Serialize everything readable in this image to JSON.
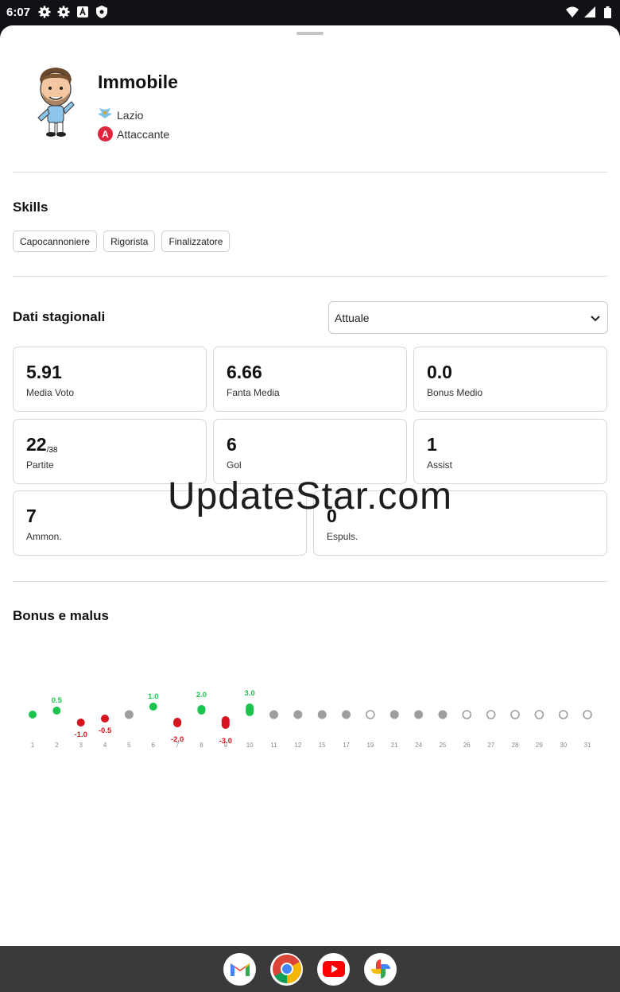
{
  "status": {
    "time": "6:07"
  },
  "player": {
    "name": "Immobile",
    "team": "Lazio",
    "role_letter": "A",
    "role": "Attaccante"
  },
  "skills": {
    "title": "Skills",
    "items": [
      "Capocannoniere",
      "Rigorista",
      "Finalizzatore"
    ]
  },
  "season": {
    "title": "Dati stagionali",
    "selected": "Attuale",
    "stats": [
      {
        "value": "5.91",
        "label": "Media Voto"
      },
      {
        "value": "6.66",
        "label": "Fanta Media"
      },
      {
        "value": "0.0",
        "label": "Bonus Medio"
      },
      {
        "value": "22",
        "sub": "/38",
        "label": "Partite"
      },
      {
        "value": "6",
        "label": "Gol"
      },
      {
        "value": "1",
        "label": "Assist"
      },
      {
        "value": "7",
        "label": "Ammon."
      },
      {
        "value": "0",
        "label": "Espuls."
      }
    ]
  },
  "watermark": "UpdateStar.com",
  "bonus": {
    "title": "Bonus e malus"
  },
  "chart_data": {
    "type": "scatter",
    "categories": [
      "1",
      "2",
      "3",
      "4",
      "5",
      "6",
      "7",
      "8",
      "9",
      "10",
      "11",
      "12",
      "15",
      "17",
      "19",
      "21",
      "24",
      "25",
      "26",
      "27",
      "28",
      "29",
      "30",
      "31"
    ],
    "values": [
      0,
      0.5,
      -1.0,
      -0.5,
      null,
      1.0,
      -2.0,
      2.0,
      -3.0,
      3.0,
      null,
      null,
      null,
      null,
      null,
      null,
      null,
      null,
      null,
      null,
      null,
      null,
      null,
      null
    ],
    "labels": [
      "",
      "0.5",
      "-1.0",
      "-0.5",
      "",
      "1.0",
      "-2.0",
      "2.0",
      "-3.0",
      "3.0",
      "",
      "",
      "",
      "",
      "",
      "",
      "",
      "",
      "",
      "",
      "",
      "",
      "",
      ""
    ],
    "state": [
      "played",
      "played",
      "played",
      "played",
      "no-vote",
      "played",
      "played",
      "played",
      "played",
      "played",
      "no-vote",
      "no-vote",
      "no-vote",
      "no-vote",
      "future",
      "no-vote",
      "no-vote",
      "no-vote",
      "future",
      "future",
      "future",
      "future",
      "future",
      "future"
    ],
    "colors": {
      "positive": "#1cc44f",
      "negative": "#d6151e",
      "neutral": "#9e9e9e"
    }
  },
  "nav_apps": [
    "gmail-icon",
    "chrome-icon",
    "youtube-icon",
    "photos-icon"
  ]
}
